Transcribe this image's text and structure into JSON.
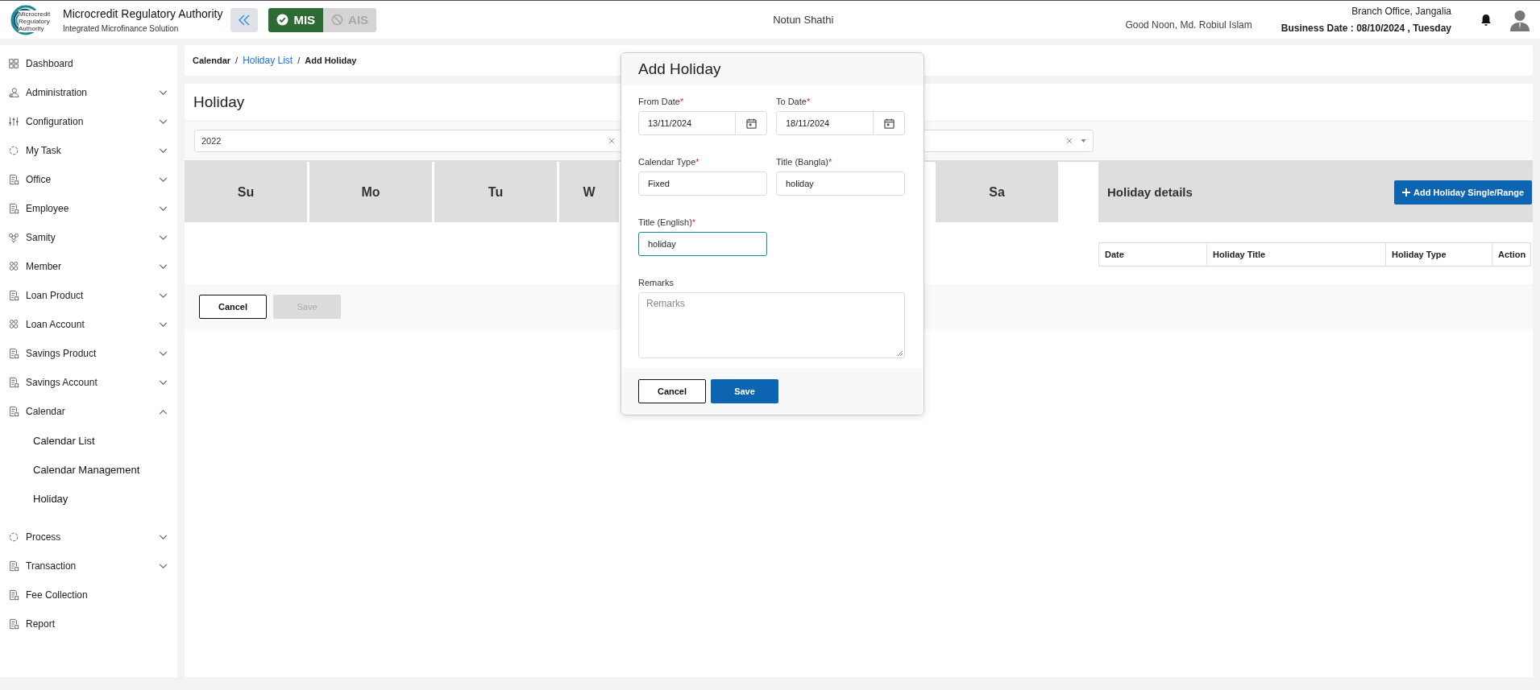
{
  "header": {
    "logo_text": "Microcredit Regulatory Authority",
    "title": "Microcredit Regulatory Authority",
    "subtitle": "Integrated Microfinance Solution",
    "modules": [
      {
        "label": "MIS",
        "selected": true
      },
      {
        "label": "AIS",
        "selected": false
      }
    ],
    "center_text": "Notun Shathi",
    "greeting": "Good Noon, Md. Robiul Islam",
    "branch": "Branch Office, Jangalia",
    "business_date": "Business Date : 08/10/2024 , Tuesday"
  },
  "sidebar": {
    "items": [
      {
        "label": "Dashboard",
        "kind": "link"
      },
      {
        "label": "Administration",
        "kind": "group",
        "expanded": false
      },
      {
        "label": "Configuration",
        "kind": "group",
        "expanded": false
      },
      {
        "label": "My Task",
        "kind": "group",
        "expanded": false
      },
      {
        "label": "Office",
        "kind": "group",
        "expanded": false
      },
      {
        "label": "Employee",
        "kind": "group",
        "expanded": false
      },
      {
        "label": "Samity",
        "kind": "group",
        "expanded": false
      },
      {
        "label": "Member",
        "kind": "group",
        "expanded": false
      },
      {
        "label": "Loan Product",
        "kind": "group",
        "expanded": false
      },
      {
        "label": "Loan Account",
        "kind": "group",
        "expanded": false
      },
      {
        "label": "Savings Product",
        "kind": "group",
        "expanded": false
      },
      {
        "label": "Savings Account",
        "kind": "group",
        "expanded": false
      },
      {
        "label": "Calendar",
        "kind": "group",
        "expanded": true,
        "children": [
          {
            "label": "Calendar List"
          },
          {
            "label": "Calendar Management"
          },
          {
            "label": "Holiday"
          }
        ]
      },
      {
        "label": "Process",
        "kind": "group",
        "expanded": false
      },
      {
        "label": "Transaction",
        "kind": "group",
        "expanded": false
      },
      {
        "label": "Fee Collection",
        "kind": "link"
      },
      {
        "label": "Report",
        "kind": "link"
      }
    ]
  },
  "breadcrumb": [
    {
      "label": "Calendar",
      "kind": "text"
    },
    {
      "label": "/",
      "kind": "separator"
    },
    {
      "label": "Holiday List",
      "kind": "link"
    },
    {
      "label": "/",
      "kind": "separator"
    },
    {
      "label": "Add Holiday",
      "kind": "current"
    }
  ],
  "page": {
    "title": "Holiday",
    "filters": [
      {
        "kind": "select",
        "value": "2022"
      },
      {
        "kind": "select"
      }
    ],
    "days": [
      {
        "label": "Su"
      },
      {
        "label": "Mo"
      },
      {
        "label": "Tu"
      },
      {
        "label": "W"
      },
      {
        "label": "Sa"
      }
    ],
    "details": {
      "title": "Holiday details",
      "add_button": "Add Holiday Single/Range",
      "columns": [
        "Date",
        "Holiday Title",
        "Holiday Type",
        "Action"
      ]
    },
    "buttons": [
      {
        "label": "Cancel",
        "kind": "outline",
        "disabled": false
      },
      {
        "label": "Save",
        "kind": "primary",
        "disabled": true
      }
    ]
  },
  "modal": {
    "title": "Add Holiday",
    "fields": [
      {
        "label": "From Date",
        "required_mark": "*",
        "kind": "date",
        "value": "13/11/2024",
        "focused": false
      },
      {
        "label": "To Date",
        "required_mark": "*",
        "kind": "date",
        "value": "18/11/2024",
        "focused": false
      },
      {
        "label": "Calendar Type",
        "required_mark": "*",
        "kind": "text",
        "value": "Fixed",
        "focused": false
      },
      {
        "label": "Title (Bangla)",
        "required_mark": "*",
        "kind": "text",
        "value": "holiday",
        "focused": false
      },
      {
        "label": "Title (English)",
        "required_mark": "*",
        "kind": "text",
        "value": "holiday",
        "focused": true
      },
      {
        "label": "Remarks",
        "kind": "textarea",
        "placeholder": "Remarks",
        "focused": false
      }
    ],
    "buttons": [
      {
        "label": "Cancel",
        "kind": "outline",
        "disabled": false
      },
      {
        "label": "Save",
        "kind": "primary",
        "disabled": false
      }
    ]
  }
}
